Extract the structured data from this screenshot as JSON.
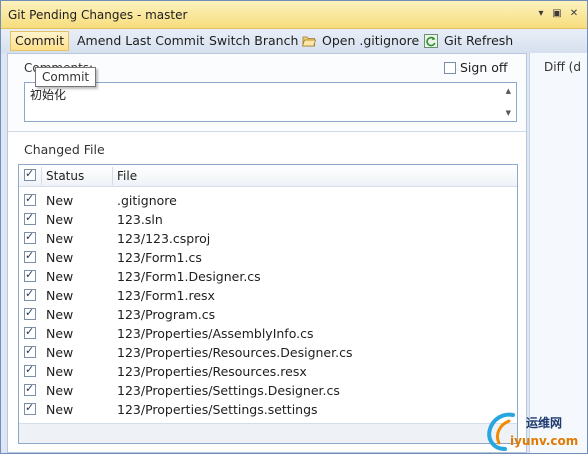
{
  "window": {
    "title": "Git Pending Changes - master"
  },
  "title_buttons": {
    "dropdown": "▾",
    "pin": "▣",
    "close": "✕"
  },
  "toolbar": {
    "commit_label": "Commit",
    "amend_label": "Amend Last Commit",
    "switch_branch_label": "Switch Branch",
    "open_gitignore_label": "Open .gitignore",
    "git_refresh_label": "Git Refresh"
  },
  "comments": {
    "label": "Comments:",
    "value": "初始化",
    "signoff_label": "Sign off",
    "signoff_checked": false
  },
  "tooltip": {
    "text": "Commit"
  },
  "changed": {
    "label": "Changed File",
    "columns": {
      "status": "Status",
      "file": "File"
    },
    "rows": [
      {
        "status": "New",
        "file": ".gitignore"
      },
      {
        "status": "New",
        "file": "123.sln"
      },
      {
        "status": "New",
        "file": "123/123.csproj"
      },
      {
        "status": "New",
        "file": "123/Form1.cs"
      },
      {
        "status": "New",
        "file": "123/Form1.Designer.cs"
      },
      {
        "status": "New",
        "file": "123/Form1.resx"
      },
      {
        "status": "New",
        "file": "123/Program.cs"
      },
      {
        "status": "New",
        "file": "123/Properties/AssemblyInfo.cs"
      },
      {
        "status": "New",
        "file": "123/Properties/Resources.Designer.cs"
      },
      {
        "status": "New",
        "file": "123/Properties/Resources.resx"
      },
      {
        "status": "New",
        "file": "123/Properties/Settings.Designer.cs"
      },
      {
        "status": "New",
        "file": "123/Properties/Settings.settings"
      }
    ]
  },
  "diff": {
    "label": "Diff (d"
  },
  "watermark": {
    "line1": "运维网",
    "line2": "iyunv.com"
  }
}
